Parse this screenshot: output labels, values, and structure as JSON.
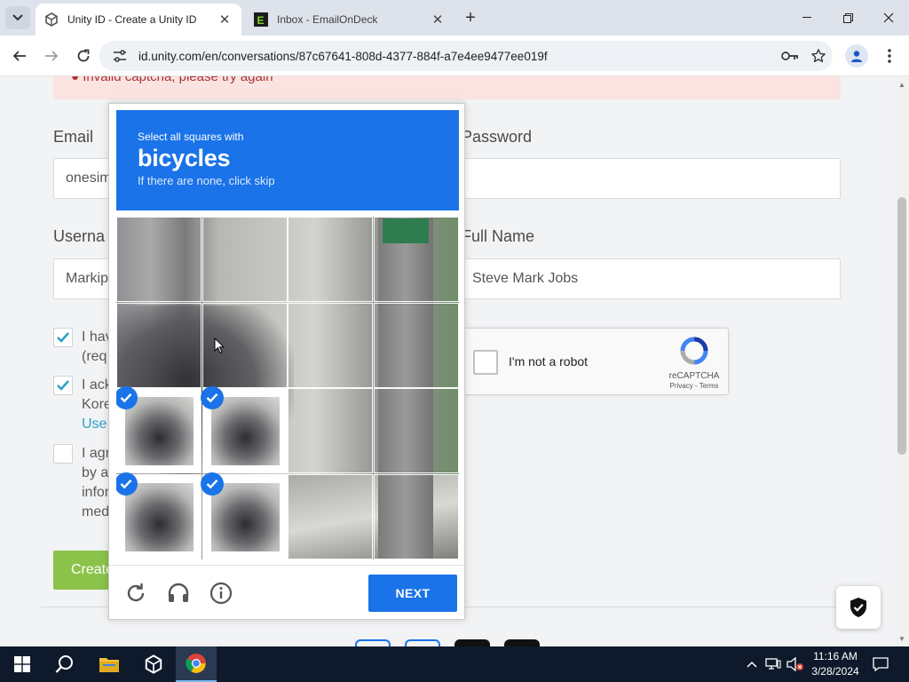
{
  "browser": {
    "tabs": [
      {
        "title": "Unity ID - Create a Unity ID",
        "active": true,
        "favicon": "unity-icon"
      },
      {
        "title": "Inbox - EmailOnDeck",
        "active": false,
        "favicon": "emailondeck-icon"
      }
    ],
    "url": "id.unity.com/en/conversations/87c67641-808d-4377-884f-a7e4ee9477ee019f"
  },
  "page": {
    "error_message": "Invalid captcha, please try again",
    "email_label": "Email",
    "email_value": "onesim",
    "password_label": "Password",
    "password_value": "",
    "username_label": "Userna",
    "username_value": "Markip",
    "fullname_label": "Full Name",
    "fullname_value": "Steve Mark Jobs",
    "checkboxes": [
      {
        "line1": "I hav",
        "line2": "(req",
        "checked": true
      },
      {
        "line1": "I ack",
        "line2": "Kore",
        "line3": "Use",
        "checked": true
      },
      {
        "line1": "I agr",
        "line2": "by a",
        "line3": "infor",
        "line4": "med",
        "checked": false
      }
    ],
    "create_button": "Create"
  },
  "recaptcha_anchor": {
    "label": "I'm not a robot",
    "brand": "reCAPTCHA",
    "privacy": "Privacy",
    "terms": "Terms",
    "separator": " - "
  },
  "challenge": {
    "instruction": "Select all squares with",
    "target": "bicycles",
    "hint": "If there are none, click skip",
    "next_label": "NEXT",
    "selected_cells": [
      8,
      9,
      12,
      13
    ],
    "icons": [
      "reload-icon",
      "audio-icon",
      "info-icon"
    ]
  },
  "taskbar": {
    "time": "11:16 AM",
    "date": "3/28/2024"
  },
  "colors": {
    "accent": "#1a73e8",
    "error_bg": "#fbe3e1",
    "create_green": "#8bc34a",
    "link": "#2aa3c9"
  }
}
